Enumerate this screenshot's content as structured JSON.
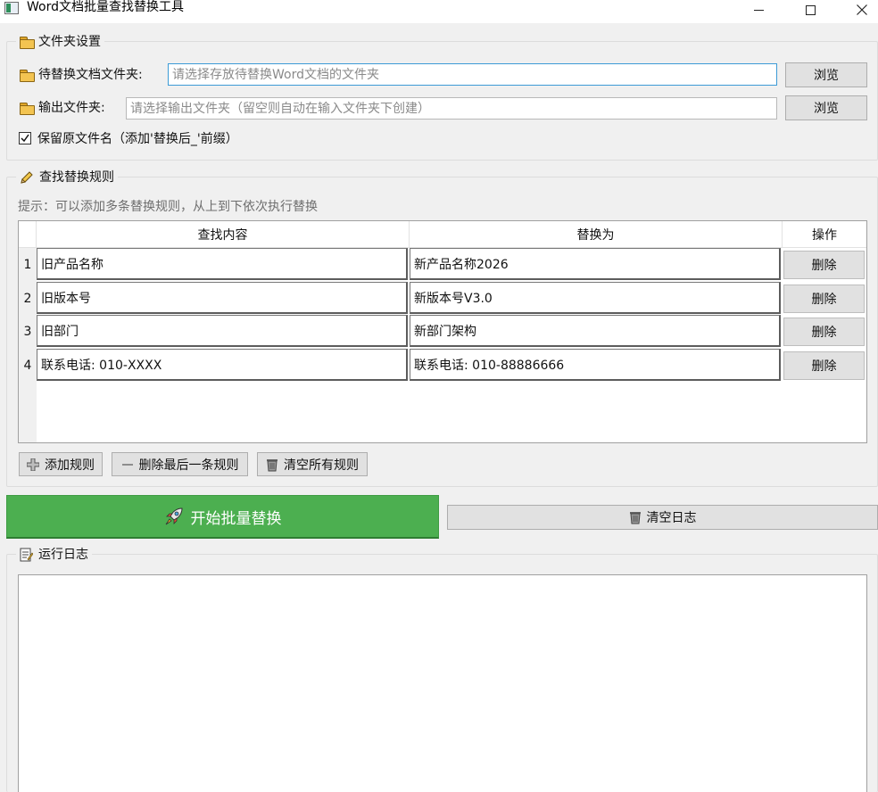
{
  "window": {
    "title": "Word文档批量查找替换工具",
    "accent_color": "#4caf50"
  },
  "folder_settings": {
    "group_title": "文件夹设置",
    "input_label": "待替换文档文件夹:",
    "input_placeholder": "请选择存放待替换Word文档的文件夹",
    "output_label": "输出文件夹:",
    "output_placeholder": "请选择输出文件夹（留空则自动在输入文件夹下创建）",
    "browse_label": "浏览",
    "keep_name_label": "保留原文件名（添加'替换后_'前缀）",
    "keep_name_checked": true
  },
  "rules": {
    "group_title": "查找替换规则",
    "hint": "提示：可以添加多条替换规则，从上到下依次执行替换",
    "columns": [
      "查找内容",
      "替换为",
      "操作"
    ],
    "rows": [
      {
        "num": "1",
        "find": "旧产品名称",
        "replace": "新产品名称2026",
        "action": "删除"
      },
      {
        "num": "2",
        "find": "旧版本号",
        "replace": "新版本号V3.0",
        "action": "删除"
      },
      {
        "num": "3",
        "find": "旧部门",
        "replace": "新部门架构",
        "action": "删除"
      },
      {
        "num": "4",
        "find": "联系电话: 010-XXXX",
        "replace": "联系电话: 010-88886666",
        "action": "删除"
      }
    ],
    "add_label": "添加规则",
    "remove_last_label": "删除最后一条规则",
    "clear_all_label": "清空所有规则"
  },
  "actions": {
    "start_label": "开始批量替换",
    "clear_log_label": "清空日志"
  },
  "log": {
    "group_title": "运行日志",
    "content": ""
  }
}
